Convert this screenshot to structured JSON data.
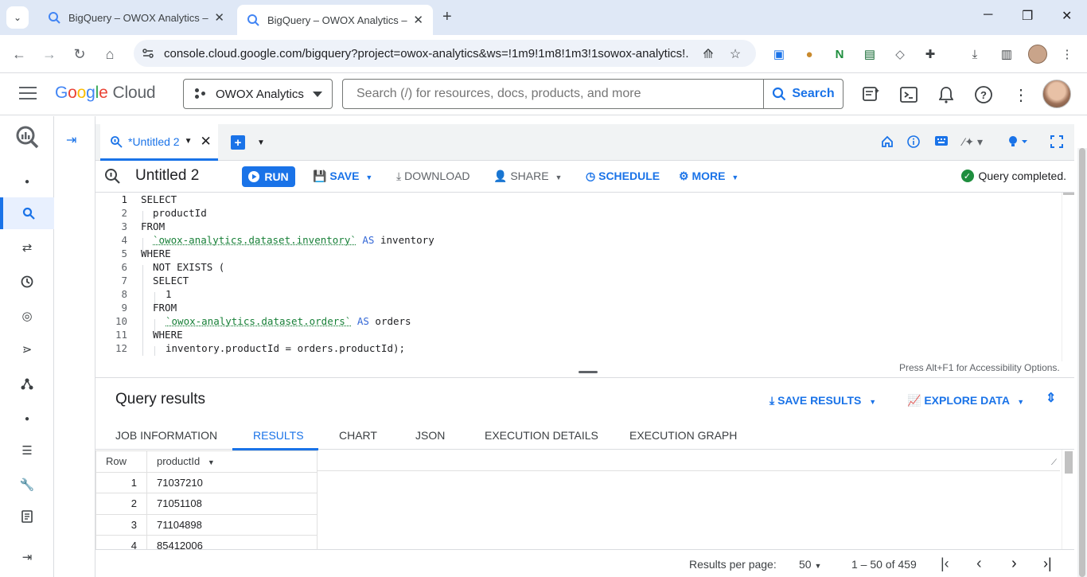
{
  "browser": {
    "tabs": [
      {
        "title": "BigQuery – OWOX Analytics – G",
        "close": "✕"
      },
      {
        "title": "BigQuery – OWOX Analytics – G",
        "close": "✕"
      }
    ],
    "new_tab": "+",
    "window_controls": {
      "minimize": "─",
      "restore": "❐",
      "close": "✕"
    },
    "url": "console.cloud.google.com/bigquery?project=owox-analytics&ws=!1m9!1m8!1m3!1sowox-analytics!..."
  },
  "gcp": {
    "logo_google": [
      "G",
      "o",
      "o",
      "g",
      "l",
      "e"
    ],
    "logo_cloud": "Cloud",
    "project": "OWOX Analytics",
    "search_placeholder": "Search (/) for resources, docs, products, and more",
    "search_button": "Search"
  },
  "editor": {
    "tab_label": "*Untitled 2",
    "query_title": "Untitled 2",
    "toolbar": {
      "run": "RUN",
      "save": "SAVE",
      "download": "DOWNLOAD",
      "share": "SHARE",
      "schedule": "SCHEDULE",
      "more": "MORE"
    },
    "status": "Query completed.",
    "lines": [
      "1",
      "2",
      "3",
      "4",
      "5",
      "6",
      "7",
      "8",
      "9",
      "10",
      "11",
      "12"
    ],
    "code": {
      "l1": "SELECT",
      "l2": "productId",
      "l3": "FROM",
      "l4_table": "`owox-analytics.dataset.inventory`",
      "l4_as": "AS",
      "l4_alias": "inventory",
      "l5": "WHERE",
      "l6": "NOT EXISTS (",
      "l7": "SELECT",
      "l8": "1",
      "l9": "FROM",
      "l10_table": "`owox-analytics.dataset.orders`",
      "l10_as": "AS",
      "l10_alias": "orders",
      "l11": "WHERE",
      "l12": "inventory.productId = orders.productId);"
    },
    "a11y_hint": "Press Alt+F1 for Accessibility Options."
  },
  "results": {
    "title": "Query results",
    "save_results": "SAVE RESULTS",
    "explore_data": "EXPLORE DATA",
    "tabs": [
      "JOB INFORMATION",
      "RESULTS",
      "CHART",
      "JSON",
      "EXECUTION DETAILS",
      "EXECUTION GRAPH"
    ],
    "columns": {
      "row": "Row",
      "productId": "productId"
    },
    "rows": [
      {
        "row": "1",
        "productId": "71037210"
      },
      {
        "row": "2",
        "productId": "71051108"
      },
      {
        "row": "3",
        "productId": "71104898"
      },
      {
        "row": "4",
        "productId": "85412006"
      }
    ],
    "pager": {
      "label": "Results per page:",
      "per_page": "50",
      "range": "1 – 50 of 459"
    }
  },
  "colors": {
    "accent": "#1a73e8",
    "success": "#1e8e3e",
    "keyword": "#3367d6",
    "string": "#188038"
  }
}
